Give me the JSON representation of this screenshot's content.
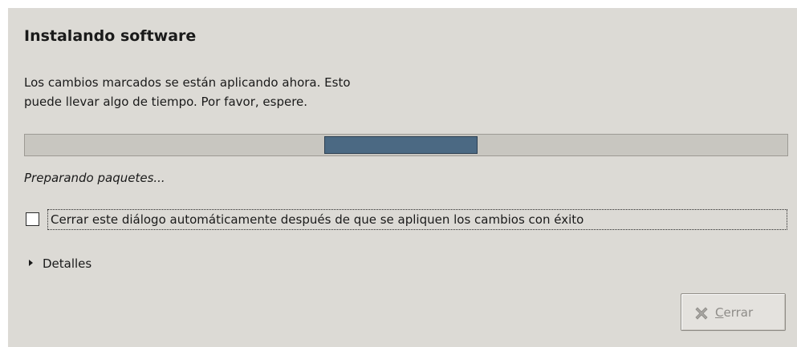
{
  "dialog": {
    "title": "Instalando software",
    "description_line1": "Los cambios marcados se están aplicando ahora. Esto",
    "description_line2": "puede llevar algo de tiempo. Por favor, espere.",
    "progress": {
      "fraction_start": 0.393,
      "fraction_end": 0.594,
      "mode": "pulse"
    },
    "status_text": "Preparando paquetes...",
    "auto_close_checkbox": {
      "label": "Cerrar este diálogo automáticamente después de que se apliquen los cambios con éxito",
      "checked": false
    },
    "details_expander": {
      "label": "Detalles",
      "icon": "triangle-right-icon",
      "expanded": false
    },
    "close_button": {
      "mnemonic": "C",
      "label_rest": "errar",
      "icon": "close-x-icon",
      "enabled": false
    }
  },
  "colors": {
    "background": "#dcdad5",
    "progress_fill": "#4b6983",
    "progress_trough": "#c8c6c0",
    "disabled_text": "#8e8c88"
  }
}
